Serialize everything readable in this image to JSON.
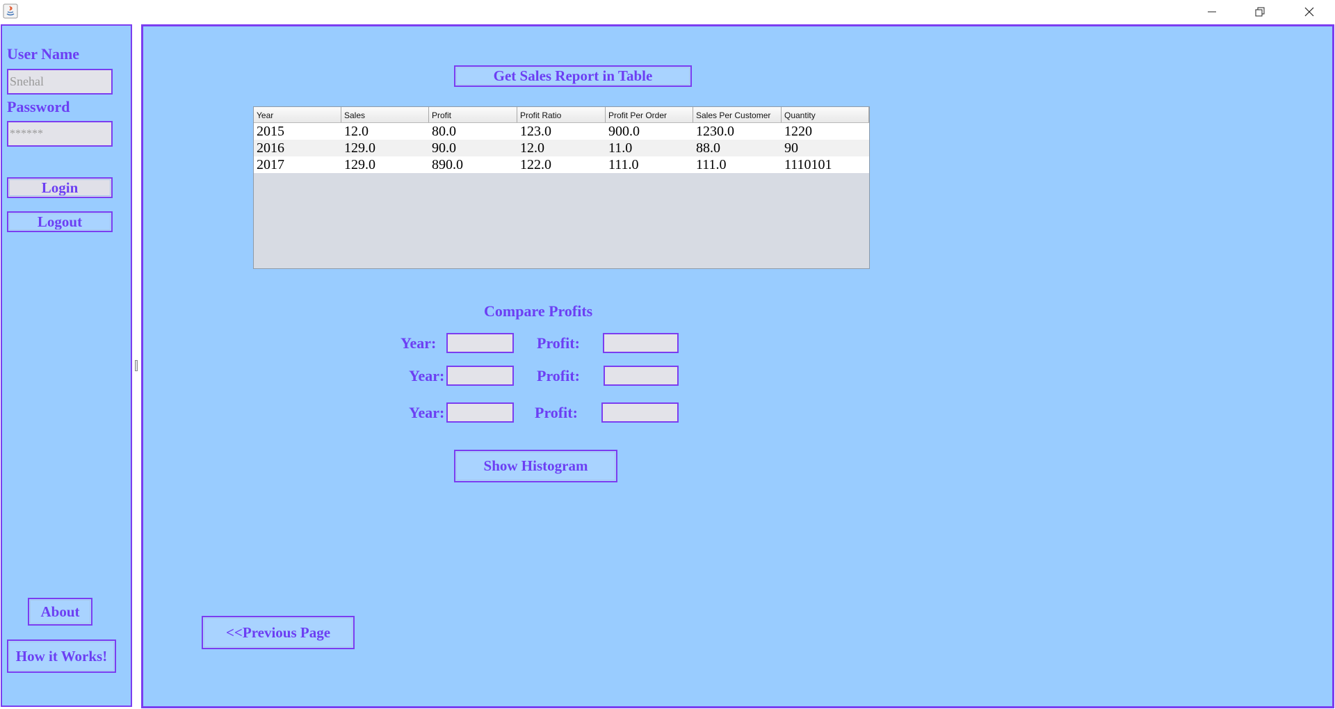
{
  "window": {
    "minimize_glyph": "—",
    "close_glyph": "✕"
  },
  "sidebar": {
    "username_label": "User Name",
    "username_value": "Snehal",
    "password_label": "Password",
    "password_value": "******",
    "login_label": "Login",
    "logout_label": "Logout",
    "about_label": "About",
    "how_label": "How it Works!"
  },
  "main": {
    "report_button": "Get  Sales Report in Table",
    "table": {
      "headers": [
        "Year",
        "Sales",
        "Profit",
        "Profit Ratio",
        "Profit Per Order",
        "Sales Per Customer",
        "Quantity"
      ],
      "rows": [
        [
          "2015",
          "12.0",
          "80.0",
          "123.0",
          "900.0",
          "1230.0",
          "1220"
        ],
        [
          "2016",
          "129.0",
          "90.0",
          "12.0",
          "11.0",
          "88.0",
          "90"
        ],
        [
          "2017",
          "129.0",
          "890.0",
          "122.0",
          "111.0",
          "111.0",
          "1110101"
        ]
      ]
    },
    "compare_title": "Compare Profits",
    "compare": [
      {
        "year_label": "Year:",
        "profit_label": "Profit:",
        "year_value": "",
        "profit_value": ""
      },
      {
        "year_label": "Year:",
        "profit_label": "Profit:",
        "year_value": "",
        "profit_value": ""
      },
      {
        "year_label": "Year:",
        "profit_label": "Profit:",
        "year_value": "",
        "profit_value": ""
      }
    ],
    "histogram_button": "Show Histogram",
    "previous_button": "<<Previous Page"
  },
  "colors": {
    "panel_bg": "#99ccff",
    "accent": "#7b3df0",
    "label_text": "#6c3ff3"
  }
}
